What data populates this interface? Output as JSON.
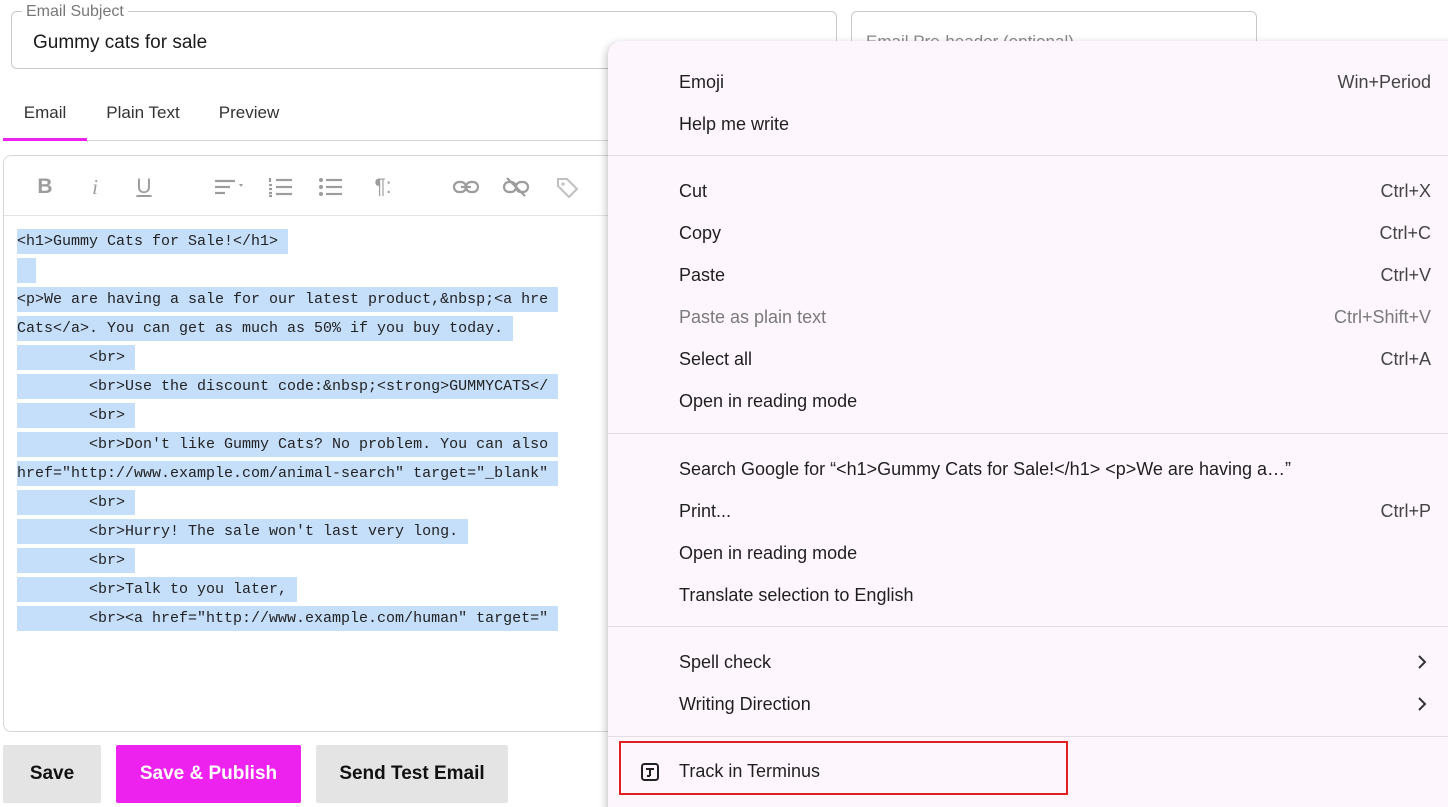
{
  "subject": {
    "legend": "Email Subject",
    "value": "Gummy cats for sale"
  },
  "preheader": {
    "placeholder": "Email Pre-header (optional)"
  },
  "tabs": [
    {
      "label": "Email"
    },
    {
      "label": "Plain Text"
    },
    {
      "label": "Preview"
    }
  ],
  "toolbar": {
    "bold": "B",
    "italic": "i",
    "underline": "U",
    "paragraph": "¶:"
  },
  "code_lines": [
    "<h1>Gummy Cats for Sale!</h1>",
    " ",
    "<p>We are having a sale for our latest product,&nbsp;<a hre",
    "Cats</a>. You can get as much as 50% if you buy today.",
    "        <br>",
    "        <br>Use the discount code:&nbsp;<strong>GUMMYCATS</",
    "        <br>",
    "        <br>Don't like Gummy Cats? No problem. You can also",
    "href=\"http://www.example.com/animal-search\" target=\"_blank\"",
    "        <br>",
    "        <br>Hurry! The sale won't last very long.",
    "        <br>",
    "        <br>Talk to you later,",
    "        <br><a href=\"http://www.example.com/human\" target=\""
  ],
  "buttons": {
    "save": "Save",
    "publish": "Save & Publish",
    "test": "Send Test Email"
  },
  "colors": {
    "accent": "#ee22ee",
    "selection": "#c5defa",
    "highlight_box": "#e02020"
  },
  "menu": {
    "emoji": {
      "label": "Emoji",
      "shortcut": "Win+Period"
    },
    "help_write": {
      "label": "Help me write"
    },
    "cut": {
      "label": "Cut",
      "shortcut": "Ctrl+X"
    },
    "copy": {
      "label": "Copy",
      "shortcut": "Ctrl+C"
    },
    "paste": {
      "label": "Paste",
      "shortcut": "Ctrl+V"
    },
    "paste_plain": {
      "label": "Paste as plain text",
      "shortcut": "Ctrl+Shift+V"
    },
    "select_all": {
      "label": "Select all",
      "shortcut": "Ctrl+A"
    },
    "reading_mode_1": {
      "label": "Open in reading mode"
    },
    "search_google": {
      "label": "Search Google for “<h1>Gummy Cats for Sale!</h1>   <p>We are having a…”"
    },
    "print": {
      "label": "Print...",
      "shortcut": "Ctrl+P"
    },
    "reading_mode_2": {
      "label": "Open in reading mode"
    },
    "translate": {
      "label": "Translate selection to English"
    },
    "spell_check": {
      "label": "Spell check"
    },
    "writing_direction": {
      "label": "Writing Direction"
    },
    "track_terminus": {
      "label": "Track in Terminus",
      "icon": "terminus-icon"
    }
  }
}
